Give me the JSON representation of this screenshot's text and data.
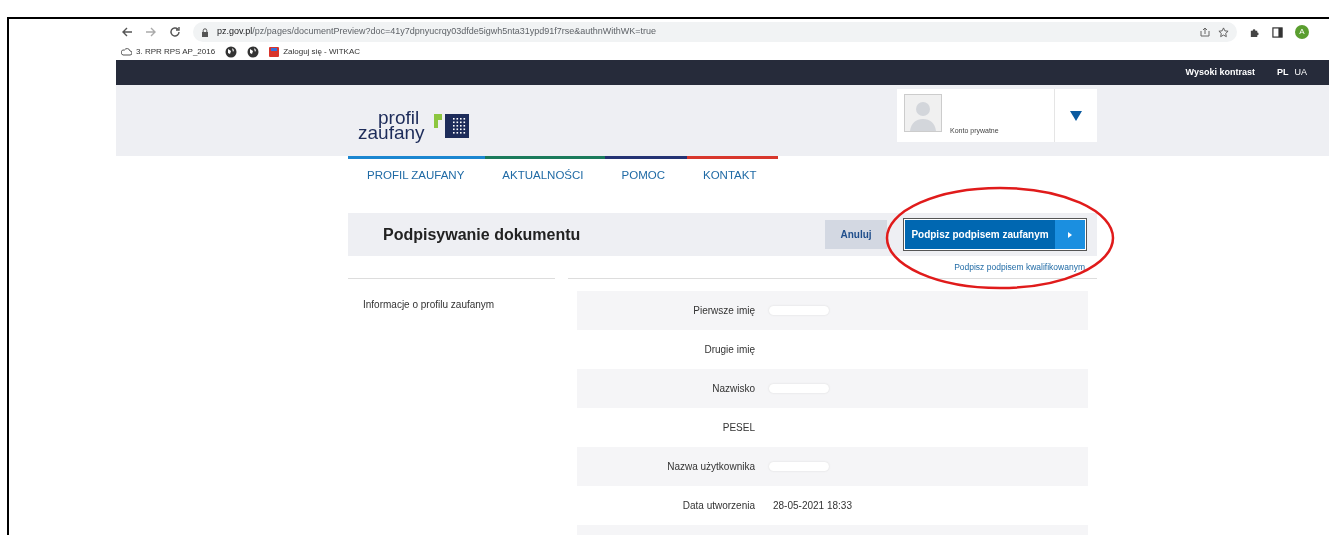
{
  "browser": {
    "url_host": "pz.gov.pl",
    "url_path": "/pz/pages/documentPreview?doc=41y7dpnyucrqy03dfde5igwh5nta31ypd91f7rse&authnWithWK=true",
    "profile_initial": "A",
    "bookmarks": [
      {
        "kind": "cloud",
        "label": "3. RPR RPS AP_2016"
      },
      {
        "kind": "globe"
      },
      {
        "kind": "globe"
      },
      {
        "kind": "app",
        "label": "Zaloguj się - WITKAC"
      }
    ]
  },
  "topbar": {
    "contrast": "Wysoki kontrast",
    "languages": [
      {
        "label": "PL",
        "selected": true
      },
      {
        "label": "UA",
        "selected": false
      }
    ]
  },
  "account": {
    "label": "Konto prywatne"
  },
  "logo": {
    "line1": "profil",
    "line2": "zaufany"
  },
  "nav": [
    "PROFIL ZAUFANY",
    "AKTUALNOŚCI",
    "POMOC",
    "KONTAKT"
  ],
  "page": {
    "title": "Podpisywanie dokumentu",
    "cancel": "Anuluj",
    "sign": "Podpisz podpisem zaufanym",
    "sign_alt": "Podpisz podpisem kwalifikowanym"
  },
  "sidebar": {
    "items": [
      "Informacje o profilu zaufanym"
    ]
  },
  "details": [
    {
      "label": "Pierwsze imię",
      "redacted": true
    },
    {
      "label": "Drugie imię",
      "redacted": false
    },
    {
      "label": "Nazwisko",
      "redacted": true
    },
    {
      "label": "PESEL",
      "redacted": false
    },
    {
      "label": "Nazwa użytkownika",
      "redacted": true
    },
    {
      "label": "Data utworzenia",
      "value": "28-05-2021 18:33",
      "redacted": false
    }
  ]
}
